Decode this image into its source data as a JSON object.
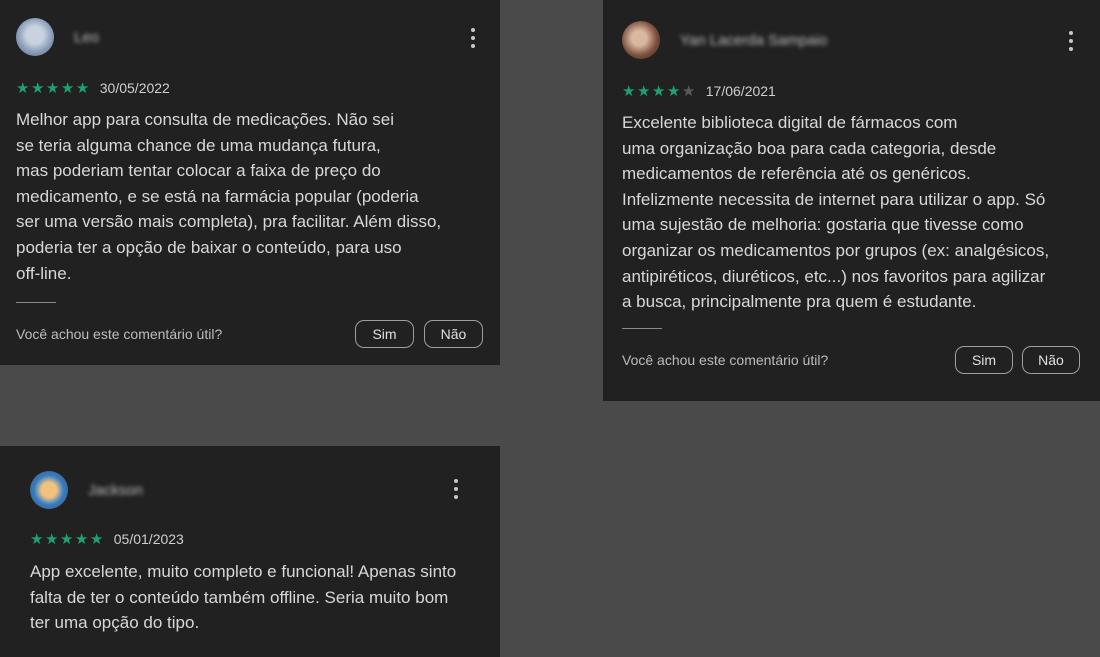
{
  "reviews": [
    {
      "author": "Leo",
      "rating": 5,
      "date": "30/05/2022",
      "text": "Melhor app para consulta de medicações. Não sei\nse teria alguma chance de uma mudança futura,\nmas poderiam tentar colocar a faixa de preço do\nmedicamento, e se está na farmácia popular (poderia\nser uma versão mais completa), pra facilitar. Além disso,\npoderia ter a opção de baixar o conteúdo, para uso\noff-line.",
      "helpful_prompt": "Você achou este comentário útil?",
      "yes_label": "Sim",
      "no_label": "Não"
    },
    {
      "author": "Yan Lacerda Sampaio",
      "rating": 4,
      "date": "17/06/2021",
      "text": "Excelente biblioteca digital de fármacos com\numa organização boa para cada categoria, desde\nmedicamentos de referência até os genéricos.\nInfelizmente necessita de internet para utilizar o app. Só\numa sujestão de melhoria: gostaria que tivesse como\norganizar os medicamentos por grupos (ex: analgésicos,\nantipiréticos, diuréticos, etc...) nos favoritos para agilizar\na busca, principalmente pra quem é estudante.",
      "helpful_prompt": "Você achou este comentário útil?",
      "yes_label": "Sim",
      "no_label": "Não"
    },
    {
      "author": "Jackson",
      "rating": 5,
      "date": "05/01/2023",
      "text": "App excelente, muito completo e funcional! Apenas sinto\nfalta de ter o conteúdo também offline. Seria muito bom\nter uma opção do tipo."
    }
  ],
  "colors": {
    "page_bg": "#4a4a4a",
    "card_bg": "#212121",
    "star_on": "#1aa36e",
    "star_off": "#5a5a5a"
  },
  "icons": {
    "menu": "more-vert-icon",
    "star": "star-icon"
  }
}
